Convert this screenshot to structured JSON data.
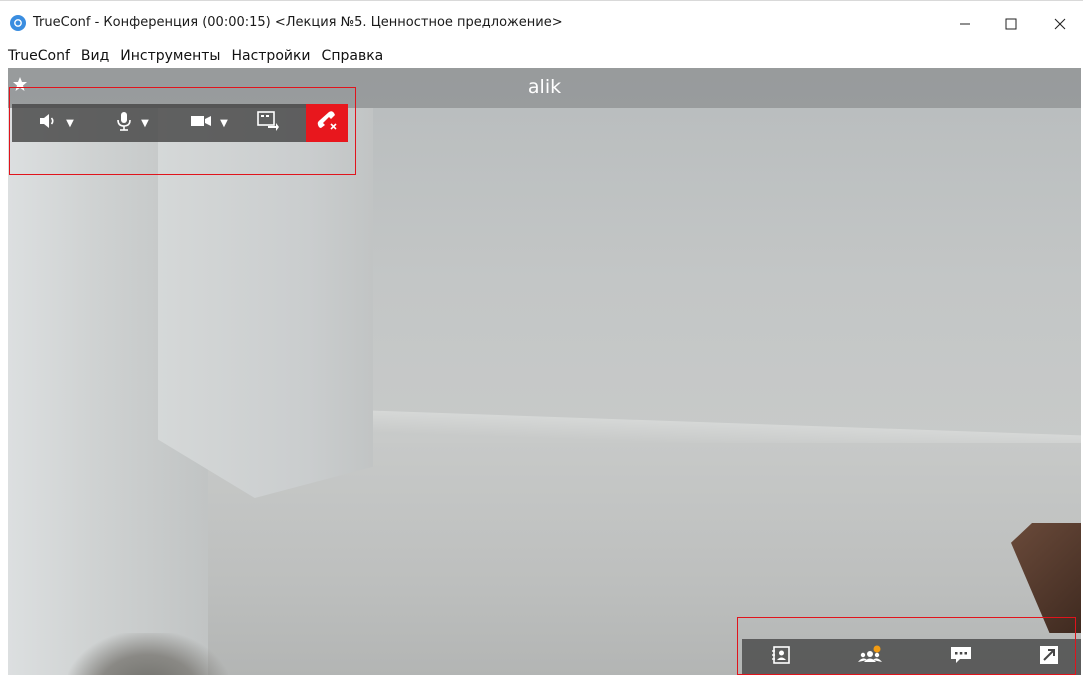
{
  "window": {
    "title": "TrueConf - Конференция (00:00:15) <Лекция №5. Ценностное предложение>",
    "controls": {
      "minimize": "—",
      "maximize": "☐",
      "close": "✕"
    }
  },
  "menu": {
    "items": [
      "TrueConf",
      "Вид",
      "Инструменты",
      "Настройки",
      "Справка"
    ]
  },
  "video": {
    "participant_name": "alik",
    "star_icon": "star-icon"
  },
  "toolbar": {
    "buttons": [
      "speaker-icon",
      "microphone-icon",
      "camera-icon",
      "share-screen-icon",
      "hangup-icon"
    ],
    "hangup_color": "#e8171d"
  },
  "bottom_panel": {
    "buttons": [
      "contacts-icon",
      "participants-icon",
      "chat-icon",
      "expand-icon"
    ],
    "notification_color": "#f39c12"
  },
  "colors": {
    "highlight": "#e0141c",
    "toolbar_bg": "#464646"
  }
}
